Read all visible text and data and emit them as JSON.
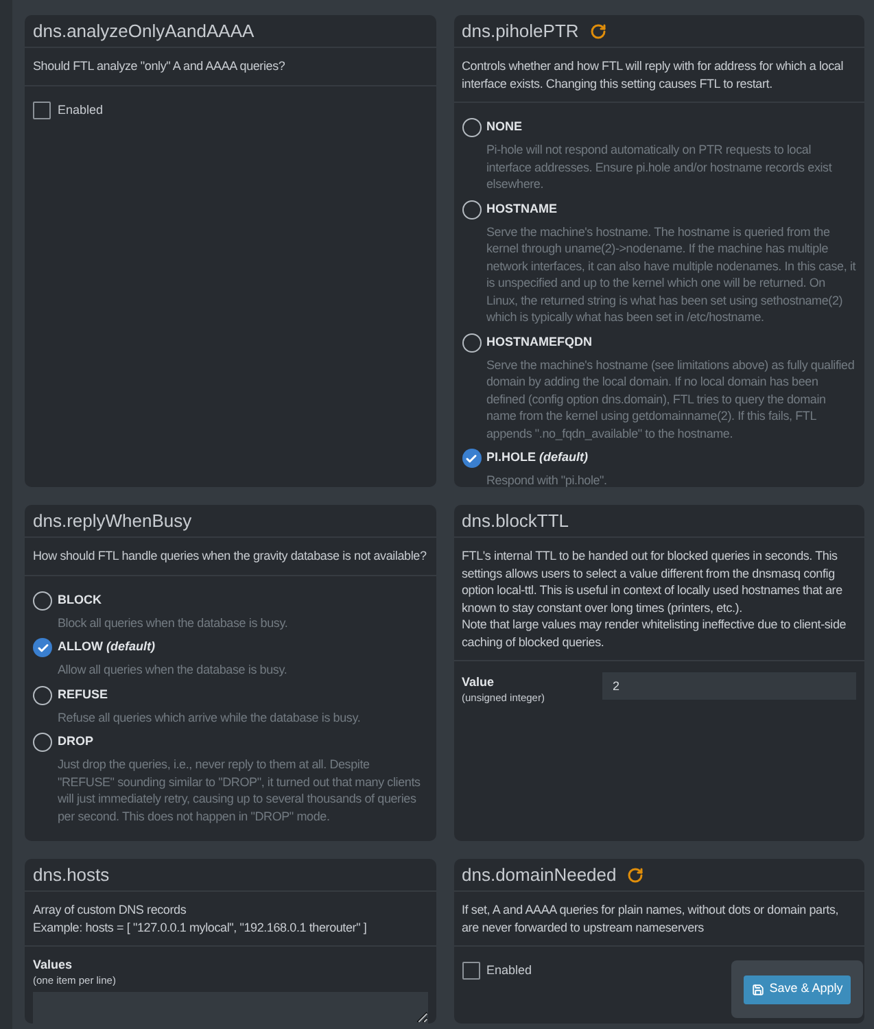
{
  "cards": [
    {
      "kind": "checkbox",
      "title": "dns.analyzeOnlyAandAAAA",
      "restart_required": false,
      "description": "Should FTL analyze \"only\" A and AAAA queries?",
      "checkbox": {
        "label": "Enabled",
        "checked": false
      }
    },
    {
      "kind": "radio",
      "title": "dns.piholePTR",
      "restart_required": true,
      "description": "Controls whether and how FTL will reply with for address for which a local interface exists. Changing this setting causes FTL to restart.",
      "options": [
        {
          "label": "NONE",
          "selected": false,
          "description": "Pi-hole will not respond automatically on PTR requests to local interface addresses. Ensure pi.hole and/or hostname records exist elsewhere."
        },
        {
          "label": "HOSTNAME",
          "selected": false,
          "description": "Serve the machine's hostname. The hostname is queried from the kernel through uname(2)->nodename. If the machine has multiple network interfaces, it can also have multiple nodenames. In this case, it is unspecified and up to the kernel which one will be returned. On Linux, the returned string is what has been set using sethostname(2) which is typically what has been set in /etc/hostname."
        },
        {
          "label": "HOSTNAMEFQDN",
          "selected": false,
          "description": "Serve the machine's hostname (see limitations above) as fully qualified domain by adding the local domain. If no local domain has been defined (config option dns.domain), FTL tries to query the domain name from the kernel using getdomainname(2). If this fails, FTL appends \".no_fqdn_available\" to the hostname."
        },
        {
          "label": "PI.HOLE *(default)*",
          "selected": true,
          "description": "Respond with \"pi.hole\"."
        }
      ]
    },
    {
      "kind": "radio",
      "title": "dns.replyWhenBusy",
      "restart_required": false,
      "description": "How should FTL handle queries when the gravity database is not available?",
      "options": [
        {
          "label": "BLOCK",
          "selected": false,
          "description": "Block all queries when the database is busy."
        },
        {
          "label": "ALLOW *(default)*",
          "selected": true,
          "description": "Allow all queries when the database is busy."
        },
        {
          "label": "REFUSE",
          "selected": false,
          "description": "Refuse all queries which arrive while the database is busy."
        },
        {
          "label": "DROP",
          "selected": false,
          "description": "Just drop the queries, i.e., never reply to them at all. Despite \"REFUSE\" sounding similar to \"DROP\", it turned out that many clients will just immediately retry, causing up to several thousands of queries per second. This does not happen in \"DROP\" mode."
        }
      ]
    },
    {
      "kind": "number",
      "title": "dns.blockTTL",
      "restart_required": false,
      "description": "FTL's internal TTL to be handed out for blocked queries in seconds. This settings allows users to select a value different from the dnsmasq config option local-ttl. This is useful in context of locally used hostnames that are known to stay constant over long times (printers, etc.).\nNote that large values may render whitelisting ineffective due to client-side caching of blocked queries.",
      "field": {
        "label": "Value",
        "hint": "(unsigned integer)",
        "value": "2"
      }
    },
    {
      "kind": "textarea",
      "title": "dns.hosts",
      "restart_required": false,
      "description": "Array of custom DNS records\nExample: hosts = [ \"127.0.0.1 mylocal\", \"192.168.0.1 therouter\" ]",
      "field": {
        "label": "Values",
        "hint": "(one item per line)"
      }
    },
    {
      "kind": "checkbox",
      "title": "dns.domainNeeded",
      "restart_required": true,
      "description": "If set, A and AAAA queries for plain names, without dots or domain parts, are never forwarded to upstream nameservers",
      "checkbox": {
        "label": "Enabled",
        "checked": false
      }
    }
  ],
  "save_button": {
    "label": "Save & Apply"
  }
}
